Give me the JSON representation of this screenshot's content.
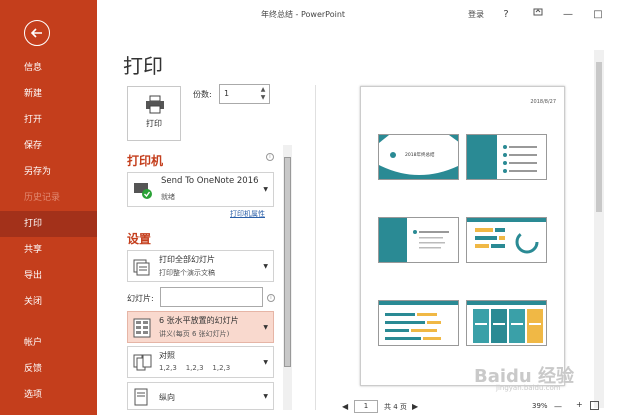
{
  "window": {
    "title": "年终总结 - PowerPoint",
    "login": "登录",
    "help": "?",
    "minimize": "—",
    "maximize": "□",
    "close": "✕"
  },
  "sidebar": {
    "items": [
      {
        "label": "信息",
        "state": "normal"
      },
      {
        "label": "新建",
        "state": "normal"
      },
      {
        "label": "打开",
        "state": "normal"
      },
      {
        "label": "保存",
        "state": "normal"
      },
      {
        "label": "另存为",
        "state": "normal"
      },
      {
        "label": "历史记录",
        "state": "disabled"
      },
      {
        "label": "打印",
        "state": "active"
      },
      {
        "label": "共享",
        "state": "normal"
      },
      {
        "label": "导出",
        "state": "normal"
      },
      {
        "label": "关闭",
        "state": "normal"
      },
      {
        "label": "帐户",
        "state": "normal"
      },
      {
        "label": "反馈",
        "state": "normal"
      },
      {
        "label": "选项",
        "state": "normal"
      }
    ]
  },
  "main": {
    "title": "打印",
    "print_button": "打印",
    "copies_label": "份数:",
    "copies_value": "1",
    "printer_heading": "打印机",
    "printer_name": "Send To OneNote 2016",
    "printer_status": "就绪",
    "printer_properties": "打印机属性",
    "settings_heading": "设置",
    "setting_range_title": "打印全部幻灯片",
    "setting_range_sub": "打印整个演示文稿",
    "slides_label": "幻灯片:",
    "setting_layout_title": "6 张水平放置的幻灯片",
    "setting_layout_sub": "讲义(每页 6 张幻灯片)",
    "setting_collate_title": "对照",
    "setting_collate_sub": "1,2,3    1,2,3    1,2,3",
    "setting_orientation_title": "纵向"
  },
  "preview": {
    "date": "2018/8/27",
    "slide1_title": "2018年终总结",
    "page_current": "1",
    "page_total": "共 4 页",
    "zoom": "39%"
  },
  "watermark": {
    "main": "Baidu 经验",
    "sub": "jingyan.baidu.com"
  },
  "colors": {
    "accent": "#c43e1c",
    "teal": "#2a8a94",
    "highlight": "#f9d9ce"
  }
}
